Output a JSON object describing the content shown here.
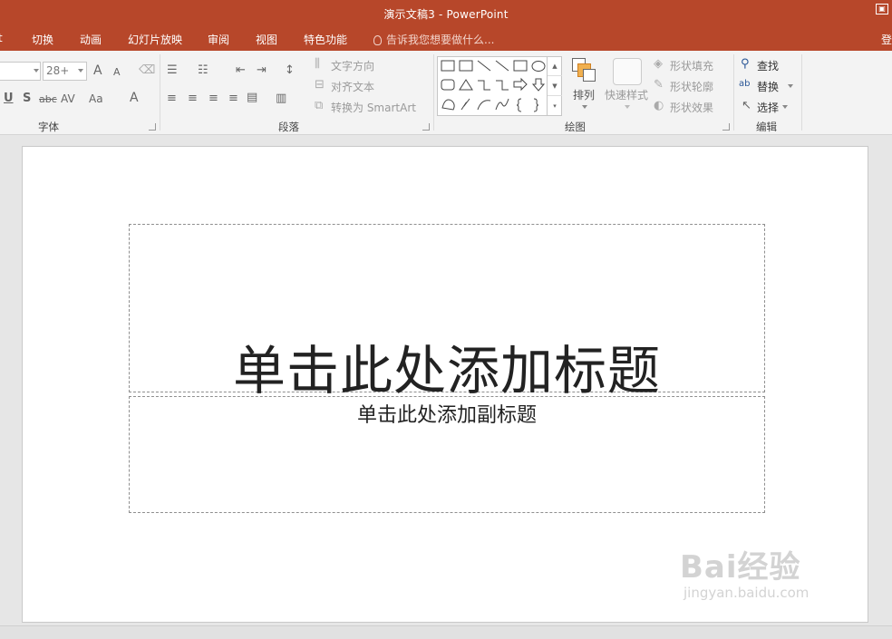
{
  "window": {
    "title": "演示文稿3 - PowerPoint"
  },
  "tabs": [
    {
      "label": "切换"
    },
    {
      "label": "动画"
    },
    {
      "label": "幻灯片放映"
    },
    {
      "label": "审阅"
    },
    {
      "label": "视图"
    },
    {
      "label": "特色功能"
    }
  ],
  "tab_partial_left": "t",
  "tellme": {
    "placeholder": "告诉我您想要做什么..."
  },
  "signin": "登",
  "ribbon": {
    "font": {
      "label": "字体",
      "size_value": "28+",
      "grow": "A",
      "shrink": "A",
      "underline": "U",
      "shadow": "S",
      "strike": "abc",
      "spacing": "AV",
      "case": "Aa",
      "color": "A"
    },
    "paragraph": {
      "label": "段落",
      "text_direction": "文字方向",
      "align_text": "对齐文本",
      "convert_smartart": "转换为 SmartArt"
    },
    "drawing": {
      "label": "绘图",
      "arrange": "排列",
      "quick_styles": "快速样式",
      "shape_fill": "形状填充",
      "shape_outline": "形状轮廓",
      "shape_effects": "形状效果"
    },
    "editing": {
      "label": "编辑",
      "find": "查找",
      "replace": "替换",
      "select": "选择"
    }
  },
  "slide": {
    "title_placeholder": "单击此处添加标题",
    "subtitle_placeholder": "单击此处添加副标题"
  },
  "watermark": {
    "brand": "Bai经验",
    "url": "jingyan.baidu.com"
  },
  "colors": {
    "accent": "#b7472a",
    "ribbon_bg": "#f3f3f3",
    "workspace_bg": "#e6e6e6"
  }
}
